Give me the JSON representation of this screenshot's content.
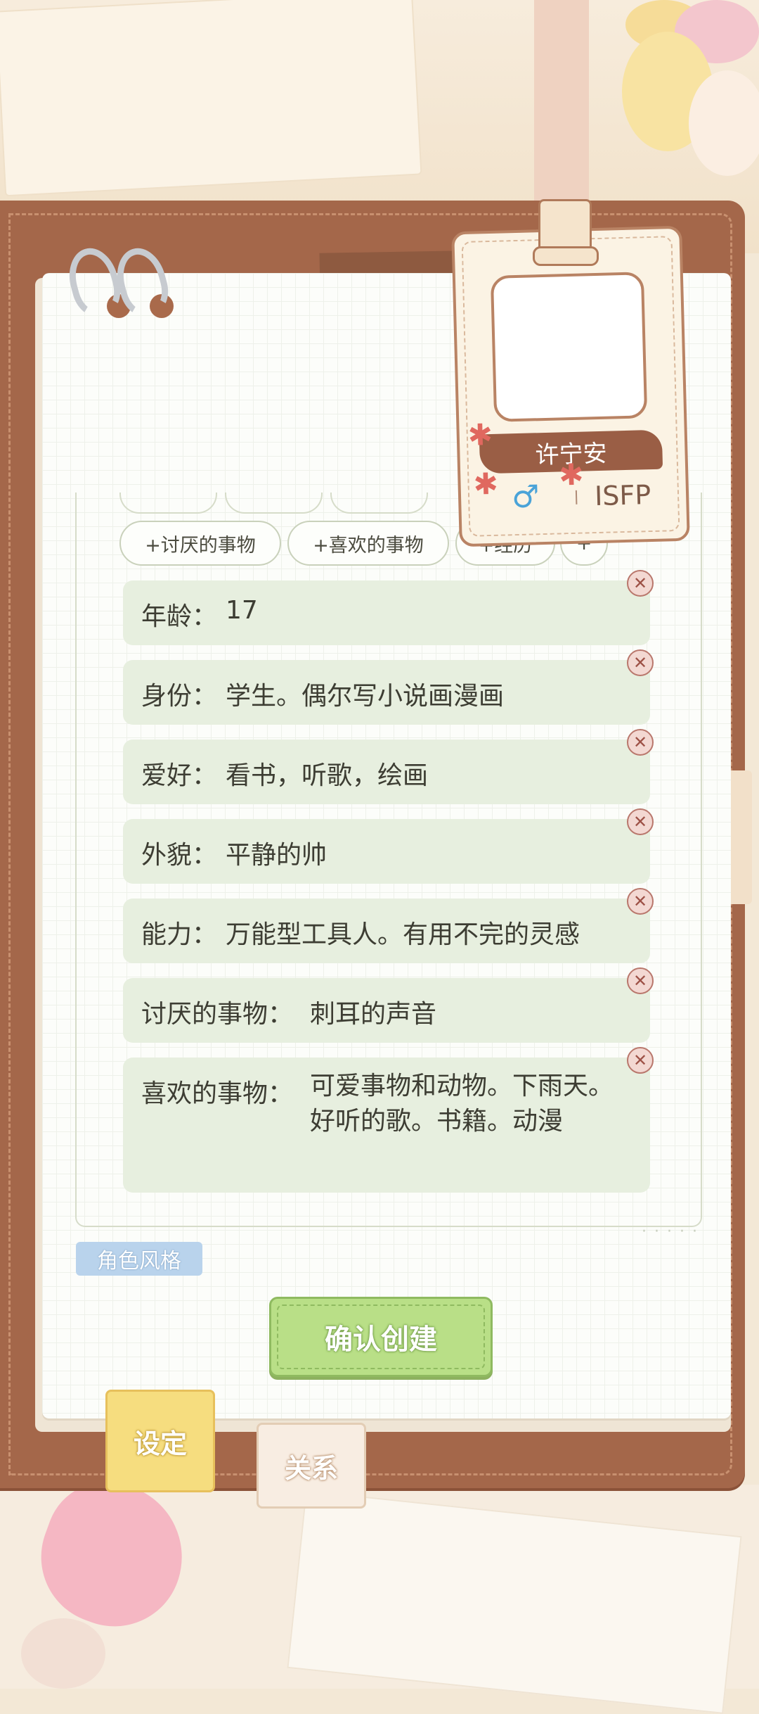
{
  "chips": [
    {
      "label": "+讨厌的事物"
    },
    {
      "label": "+喜欢的事物"
    },
    {
      "label": "+经历"
    },
    {
      "label": "+"
    }
  ],
  "items": [
    {
      "key": "年龄：",
      "value": "17"
    },
    {
      "key": "身份：",
      "value": "学生。偶尔写小说画漫画"
    },
    {
      "key": "爱好：",
      "value": "看书，听歌，绘画"
    },
    {
      "key": "外貌：",
      "value": "平静的帅"
    },
    {
      "key": "能力：",
      "value": "万能型工具人。有用不完的灵感"
    },
    {
      "key": "讨厌的事物：",
      "value": "刺耳的声音"
    },
    {
      "key": "喜欢的事物：",
      "value": "可爱事物和动物。下雨天。好听的歌。书籍。动漫"
    }
  ],
  "delete_icon": "✕",
  "style_label": "角色风格",
  "confirm_button": "确认创建",
  "tabs": {
    "settings": "设定",
    "relations": "关系"
  },
  "badge": {
    "name": "许宁安",
    "gender_symbol": "♂",
    "mbti": "ISFP"
  },
  "colors": {
    "item_bg": "#e7efdf",
    "confirm_bg": "#b9df87",
    "board": "#a4674a"
  }
}
